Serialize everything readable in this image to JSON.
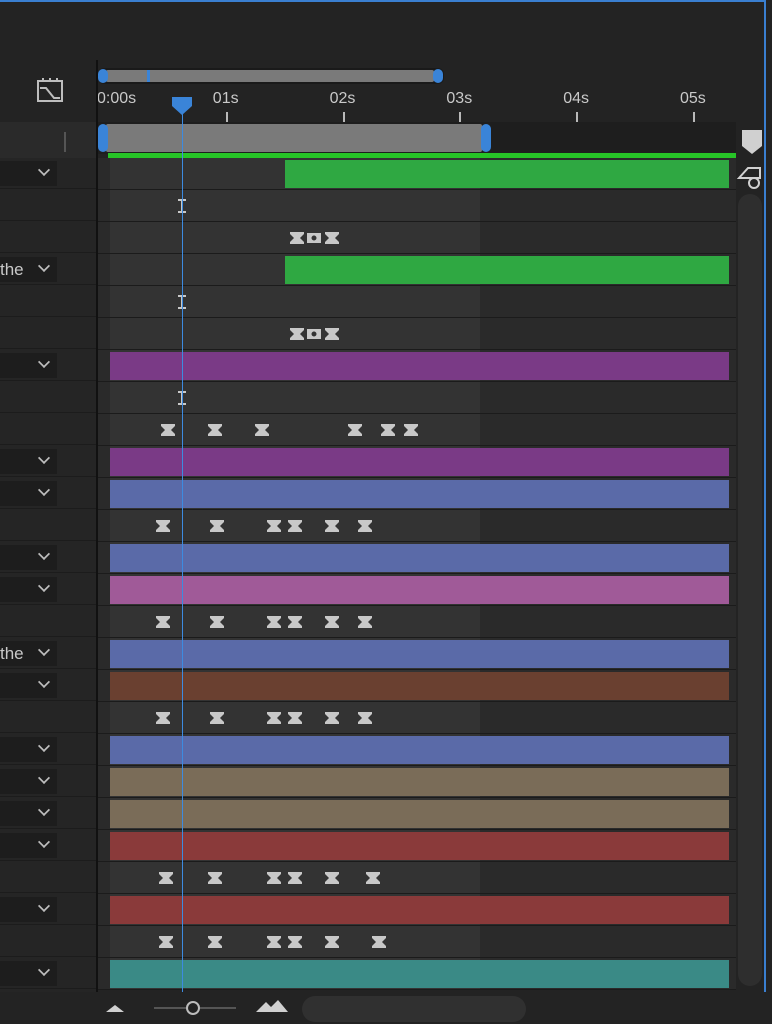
{
  "timeline": {
    "ruler_labels": [
      "0:00s",
      "01s",
      "02s",
      "03s",
      "04s",
      "05s"
    ],
    "current_time_label": "",
    "colors": {
      "accent": "#3a84d8",
      "green": "#2fa842",
      "purple": "#7a3a86",
      "blue": "#5a6aa8",
      "pink": "#a05a98",
      "brown": "#6a4030",
      "tan": "#7a6c58",
      "red": "#8a3a3a",
      "teal": "#3a8a86",
      "gray": "#5a5a5a"
    }
  },
  "layers": [
    {
      "label": "",
      "dropdown": true,
      "track": {
        "type": "bar",
        "color": "green",
        "start": 1.5,
        "end": 5.3
      }
    },
    {
      "label": "",
      "dropdown": false,
      "track": {
        "type": "keys",
        "keys": [
          {
            "t": 0.62,
            "shape": "ibeam"
          }
        ]
      }
    },
    {
      "label": "",
      "dropdown": false,
      "track": {
        "type": "keys",
        "keys": [
          {
            "t": 1.6,
            "shape": "hold"
          },
          {
            "t": 1.75,
            "shape": "dot"
          },
          {
            "t": 1.9,
            "shape": "hold"
          }
        ]
      }
    },
    {
      "label": "the",
      "dropdown": true,
      "track": {
        "type": "bar",
        "color": "green",
        "start": 1.5,
        "end": 5.3
      }
    },
    {
      "label": "",
      "dropdown": false,
      "track": {
        "type": "keys",
        "keys": [
          {
            "t": 0.62,
            "shape": "ibeam"
          }
        ]
      }
    },
    {
      "label": "",
      "dropdown": false,
      "track": {
        "type": "keys",
        "keys": [
          {
            "t": 1.6,
            "shape": "hold"
          },
          {
            "t": 1.75,
            "shape": "dot"
          },
          {
            "t": 1.9,
            "shape": "hold"
          }
        ]
      }
    },
    {
      "label": "",
      "dropdown": true,
      "track": {
        "type": "bar",
        "color": "purple",
        "start": 0.0,
        "end": 5.3
      }
    },
    {
      "label": "",
      "dropdown": false,
      "track": {
        "type": "keys",
        "keys": [
          {
            "t": 0.62,
            "shape": "ibeam"
          }
        ]
      }
    },
    {
      "label": "",
      "dropdown": false,
      "track": {
        "type": "keys",
        "keys": [
          {
            "t": 0.5,
            "shape": "hold"
          },
          {
            "t": 0.9,
            "shape": "hold"
          },
          {
            "t": 1.3,
            "shape": "hold"
          },
          {
            "t": 2.1,
            "shape": "hold"
          },
          {
            "t": 2.38,
            "shape": "hold"
          },
          {
            "t": 2.58,
            "shape": "hold"
          }
        ]
      }
    },
    {
      "label": "",
      "dropdown": true,
      "track": {
        "type": "bar",
        "color": "purple",
        "start": 0.0,
        "end": 5.3
      }
    },
    {
      "label": "",
      "dropdown": true,
      "track": {
        "type": "bar",
        "color": "blue",
        "start": 0.0,
        "end": 5.3
      }
    },
    {
      "label": "",
      "dropdown": false,
      "track": {
        "type": "keys",
        "keys": [
          {
            "t": 0.45,
            "shape": "hold"
          },
          {
            "t": 0.92,
            "shape": "hold"
          },
          {
            "t": 1.4,
            "shape": "hold"
          },
          {
            "t": 1.58,
            "shape": "hold"
          },
          {
            "t": 1.9,
            "shape": "hold"
          },
          {
            "t": 2.18,
            "shape": "hold"
          }
        ]
      }
    },
    {
      "label": "",
      "dropdown": true,
      "track": {
        "type": "bar",
        "color": "blue",
        "start": 0.0,
        "end": 5.3
      }
    },
    {
      "label": "",
      "dropdown": true,
      "track": {
        "type": "bar",
        "color": "pink",
        "start": 0.0,
        "end": 5.3
      }
    },
    {
      "label": "",
      "dropdown": false,
      "track": {
        "type": "keys",
        "keys": [
          {
            "t": 0.45,
            "shape": "hold"
          },
          {
            "t": 0.92,
            "shape": "hold"
          },
          {
            "t": 1.4,
            "shape": "hold"
          },
          {
            "t": 1.58,
            "shape": "hold"
          },
          {
            "t": 1.9,
            "shape": "hold"
          },
          {
            "t": 2.18,
            "shape": "hold"
          }
        ]
      }
    },
    {
      "label": "the",
      "dropdown": true,
      "track": {
        "type": "bar",
        "color": "blue",
        "start": 0.0,
        "end": 5.3
      }
    },
    {
      "label": "",
      "dropdown": true,
      "track": {
        "type": "bar",
        "color": "brown",
        "start": 0.0,
        "end": 5.3
      }
    },
    {
      "label": "",
      "dropdown": false,
      "track": {
        "type": "keys",
        "keys": [
          {
            "t": 0.45,
            "shape": "hold"
          },
          {
            "t": 0.92,
            "shape": "hold"
          },
          {
            "t": 1.4,
            "shape": "hold"
          },
          {
            "t": 1.58,
            "shape": "hold"
          },
          {
            "t": 1.9,
            "shape": "hold"
          },
          {
            "t": 2.18,
            "shape": "hold"
          }
        ]
      }
    },
    {
      "label": "",
      "dropdown": true,
      "track": {
        "type": "bar",
        "color": "blue",
        "start": 0.0,
        "end": 5.3
      }
    },
    {
      "label": "",
      "dropdown": true,
      "track": {
        "type": "bar",
        "color": "tan",
        "start": 0.0,
        "end": 5.3
      }
    },
    {
      "label": "",
      "dropdown": true,
      "track": {
        "type": "bar",
        "color": "tan",
        "start": 0.0,
        "end": 5.3
      }
    },
    {
      "label": "",
      "dropdown": true,
      "track": {
        "type": "bar",
        "color": "red",
        "start": 0.0,
        "end": 5.3
      }
    },
    {
      "label": "",
      "dropdown": false,
      "track": {
        "type": "keys",
        "keys": [
          {
            "t": 0.48,
            "shape": "hold"
          },
          {
            "t": 0.9,
            "shape": "hold"
          },
          {
            "t": 1.4,
            "shape": "hold"
          },
          {
            "t": 1.58,
            "shape": "hold"
          },
          {
            "t": 1.9,
            "shape": "hold"
          },
          {
            "t": 2.25,
            "shape": "hold"
          }
        ]
      }
    },
    {
      "label": "",
      "dropdown": true,
      "track": {
        "type": "bar",
        "color": "red",
        "start": 0.0,
        "end": 5.3
      }
    },
    {
      "label": "",
      "dropdown": false,
      "track": {
        "type": "keys",
        "keys": [
          {
            "t": 0.48,
            "shape": "hold"
          },
          {
            "t": 0.9,
            "shape": "hold"
          },
          {
            "t": 1.4,
            "shape": "hold"
          },
          {
            "t": 1.58,
            "shape": "hold"
          },
          {
            "t": 1.9,
            "shape": "hold"
          },
          {
            "t": 2.3,
            "shape": "hold"
          }
        ]
      }
    },
    {
      "label": "",
      "dropdown": true,
      "track": {
        "type": "bar",
        "color": "teal",
        "start": 0.0,
        "end": 5.3
      }
    }
  ],
  "playhead_time": 0.62,
  "work_area": {
    "start": 0.0,
    "end": 3.2
  },
  "icons": {
    "comp": "composition-icon",
    "zoom_out": "zoom-out-mountain-icon",
    "zoom_in": "zoom-in-mountain-icon",
    "marker": "marker-icon",
    "new_marker": "comp-marker-icon"
  }
}
